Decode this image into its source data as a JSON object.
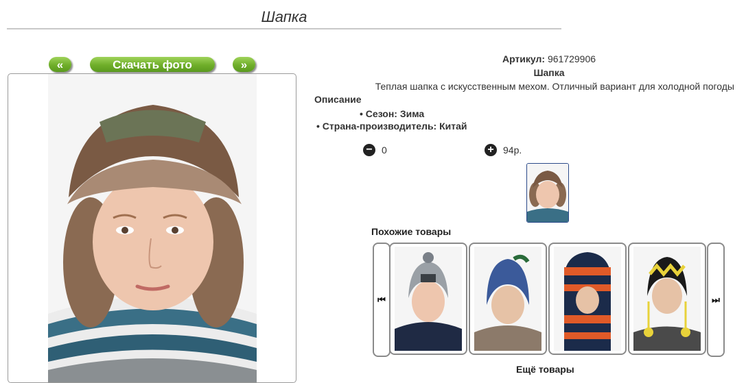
{
  "page": {
    "title": "Шапка"
  },
  "photo_nav": {
    "prev_label": "«",
    "download_label": "Скачать фото",
    "next_label": "»"
  },
  "product": {
    "sku_label": "Артикул:",
    "sku_value": "961729906",
    "name": "Шапка",
    "description": "Теплая шапка с искусственным мехом. Отличный вариант для холодной погоды",
    "description_label": "Описание",
    "attributes": [
      "Сезон: Зима",
      "Страна-производитель: Китай"
    ],
    "quantity": "0",
    "price": "94р."
  },
  "similar": {
    "label": "Похожие товары",
    "items": [
      {
        "alt": "Шапка NIKF серая"
      },
      {
        "alt": "Шапка синяя"
      },
      {
        "alt": "Шлем-шапка полосатая"
      },
      {
        "alt": "Шапка с помпонами"
      }
    ]
  },
  "more": {
    "label": "Ещё товары"
  },
  "colors": {
    "button_green": "#6fae2a",
    "thumb_border": "#2b4a8a"
  }
}
